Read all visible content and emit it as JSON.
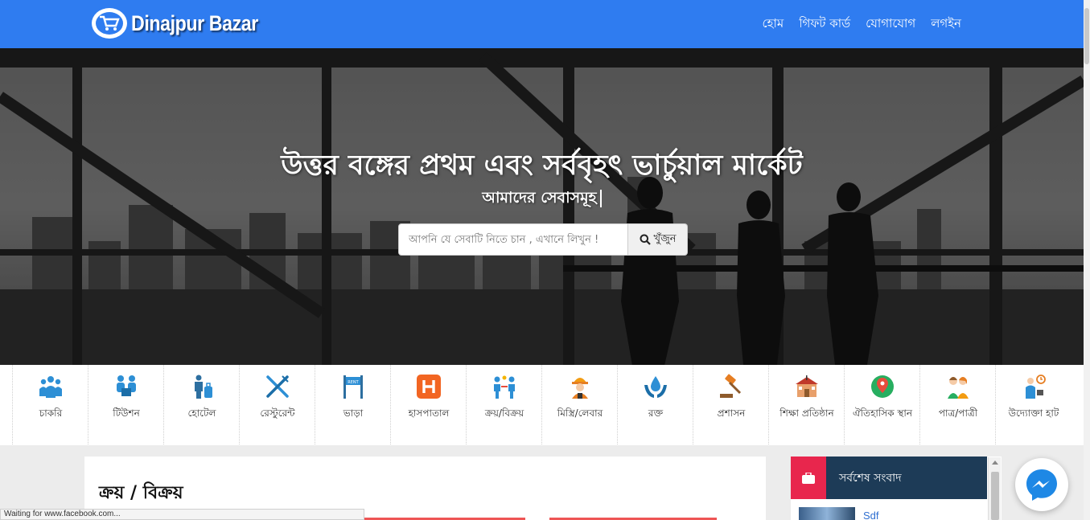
{
  "navbar": {
    "brand": "Dinajpur Bazar",
    "links": [
      "হোম",
      "গিফট কার্ড",
      "যোগাযোগ",
      "লগইন"
    ],
    "color": "#2f7cf0"
  },
  "hero": {
    "title": "উত্তর বঙ্গের প্রথম এবং সর্ববৃহৎ ভার্চুয়াল মার্কেট",
    "subtitle": "আমাদের সেবাসমূহ",
    "search_placeholder": "আপনি যে সেবাটি নিতে চান , এখানে লিখুন !",
    "search_button": "খুঁজুন"
  },
  "categories": [
    {
      "label": "চাকরি",
      "icon": "people-group-icon"
    },
    {
      "label": "টিউশন",
      "icon": "tuition-icon"
    },
    {
      "label": "হোটেল",
      "icon": "hotel-luggage-icon"
    },
    {
      "label": "রেস্টুরেন্ট",
      "icon": "fork-knife-icon"
    },
    {
      "label": "ভাড়া",
      "icon": "for-rent-sign-icon"
    },
    {
      "label": "হাসপাতাল",
      "icon": "hospital-icon"
    },
    {
      "label": "ক্রয়/বিক্রয়",
      "icon": "buy-sell-icon"
    },
    {
      "label": "মিস্ত্রি/লেবার",
      "icon": "worker-icon"
    },
    {
      "label": "রক্ত",
      "icon": "blood-drop-hands-icon"
    },
    {
      "label": "প্রশাসন",
      "icon": "gavel-icon"
    },
    {
      "label": "শিক্ষা প্রতিষ্ঠান",
      "icon": "school-building-icon"
    },
    {
      "label": "ঐতিহাসিক স্থান",
      "icon": "map-pin-icon"
    },
    {
      "label": "পাত্র/পাত্রী",
      "icon": "couple-icon"
    },
    {
      "label": "উদ্যোক্তা হাট",
      "icon": "entrepreneur-icon"
    }
  ],
  "main": {
    "heading": "ক্রয় / বিক্রয়"
  },
  "news": {
    "title": "সর্বশেষ সংবাদ",
    "items": [
      "Sdf"
    ]
  },
  "status_bar": "Waiting for www.facebook.com..."
}
